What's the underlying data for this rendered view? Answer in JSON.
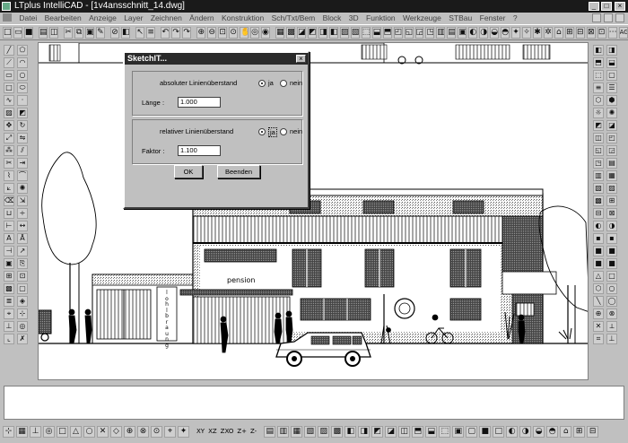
{
  "window": {
    "title": "LTplus IntelliCAD - [1v4ansschnitt_14.dwg]",
    "controls": [
      "_",
      "□",
      "×"
    ]
  },
  "menu": {
    "items": [
      "Datei",
      "Bearbeiten",
      "Anzeige",
      "Layer",
      "Zeichnen",
      "Ändern",
      "Konstruktion",
      "Sch/Txt/Bem",
      "Block",
      "3D",
      "Funktion",
      "Werkzeuge",
      "STBau",
      "Fenster",
      "?"
    ]
  },
  "toolbar_row1": {
    "end_label": "AG"
  },
  "drawing": {
    "signs": {
      "pension": "pension",
      "vertical_text": [
        "l",
        "o",
        "h",
        "l",
        "b",
        "r",
        "a",
        "u",
        "n",
        "g"
      ]
    }
  },
  "dialog": {
    "title": "SketchIT...",
    "close": "×",
    "group1": {
      "heading": "absoluter Linienüberstand",
      "yes": "ja",
      "no": "nein",
      "selected": "ja",
      "field_label": "Länge :",
      "field_value": "1.000"
    },
    "group2": {
      "heading": "relativer Linienüberstand",
      "yes": "ja",
      "no": "nein",
      "selected": "ja",
      "field_label": "Faktor :",
      "field_value": "1.100"
    },
    "ok": "OK",
    "cancel": "Beenden"
  },
  "statusbar": {
    "labels": [
      "XY",
      "XZ",
      "ZXO",
      "Z+",
      "Z-"
    ]
  }
}
